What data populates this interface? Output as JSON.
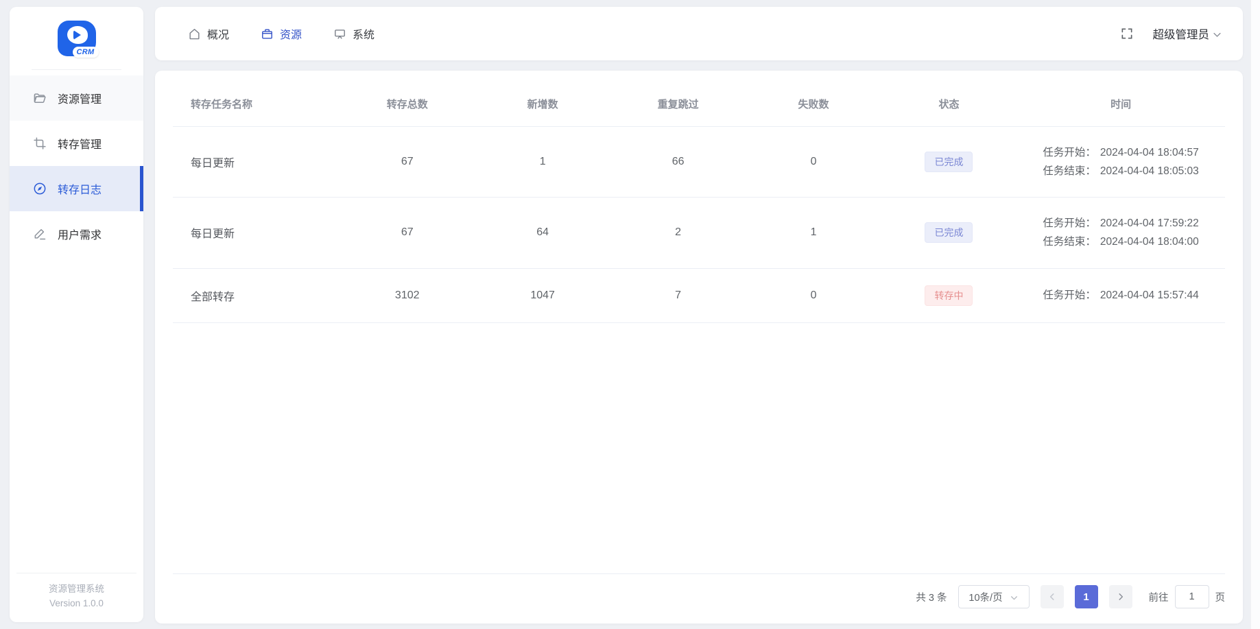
{
  "app": {
    "logo_text": "CRM",
    "footer_title": "资源管理系统",
    "footer_version": "Version 1.0.0"
  },
  "sidebar": {
    "items": [
      {
        "label": "资源管理",
        "icon": "folder-icon",
        "active": false
      },
      {
        "label": "转存管理",
        "icon": "crop-icon",
        "active": false
      },
      {
        "label": "转存日志",
        "icon": "compass-icon",
        "active": true
      },
      {
        "label": "用户需求",
        "icon": "edit-icon",
        "active": false
      }
    ]
  },
  "topbar": {
    "tabs": [
      {
        "label": "概况",
        "icon": "home-icon",
        "active": false
      },
      {
        "label": "资源",
        "icon": "briefcase-icon",
        "active": true
      },
      {
        "label": "系统",
        "icon": "monitor-icon",
        "active": false
      }
    ],
    "user_menu_label": "超级管理员"
  },
  "table": {
    "columns": {
      "name": "转存任务名称",
      "total": "转存总数",
      "added": "新增数",
      "skipped": "重复跳过",
      "failed": "失败数",
      "status": "状态",
      "time": "时间"
    },
    "rows": [
      {
        "name": "每日更新",
        "total": "67",
        "added": "1",
        "skipped": "66",
        "failed": "0",
        "status": "已完成",
        "status_type": "completed",
        "time": {
          "start_label": "任务开始：",
          "start": "2024-04-04 18:04:57",
          "end_label": "任务结束：",
          "end": "2024-04-04 18:05:03"
        }
      },
      {
        "name": "每日更新",
        "total": "67",
        "added": "64",
        "skipped": "2",
        "failed": "1",
        "status": "已完成",
        "status_type": "completed",
        "time": {
          "start_label": "任务开始：",
          "start": "2024-04-04 17:59:22",
          "end_label": "任务结束：",
          "end": "2024-04-04 18:04:00"
        }
      },
      {
        "name": "全部转存",
        "total": "3102",
        "added": "1047",
        "skipped": "7",
        "failed": "0",
        "status": "转存中",
        "status_type": "running",
        "time": {
          "start_label": "任务开始：",
          "start": "2024-04-04 15:57:44"
        }
      }
    ]
  },
  "pagination": {
    "total_text": "共 3 条",
    "page_size_label": "10条/页",
    "current_page": "1",
    "goto_label": "前往",
    "goto_value": "1",
    "goto_suffix": "页"
  },
  "colors": {
    "primary_blue": "#2b5bd7",
    "logo_blue": "#2064e8",
    "active_item_bg": "#e6ebf8",
    "badge_completed_bg": "#ebeefa",
    "badge_completed_text": "#7b87d4",
    "badge_running_bg": "#fdeded",
    "badge_running_text": "#e68f8f",
    "pagination_active_bg": "#5a6bd8",
    "page_background": "#eef0f4"
  }
}
